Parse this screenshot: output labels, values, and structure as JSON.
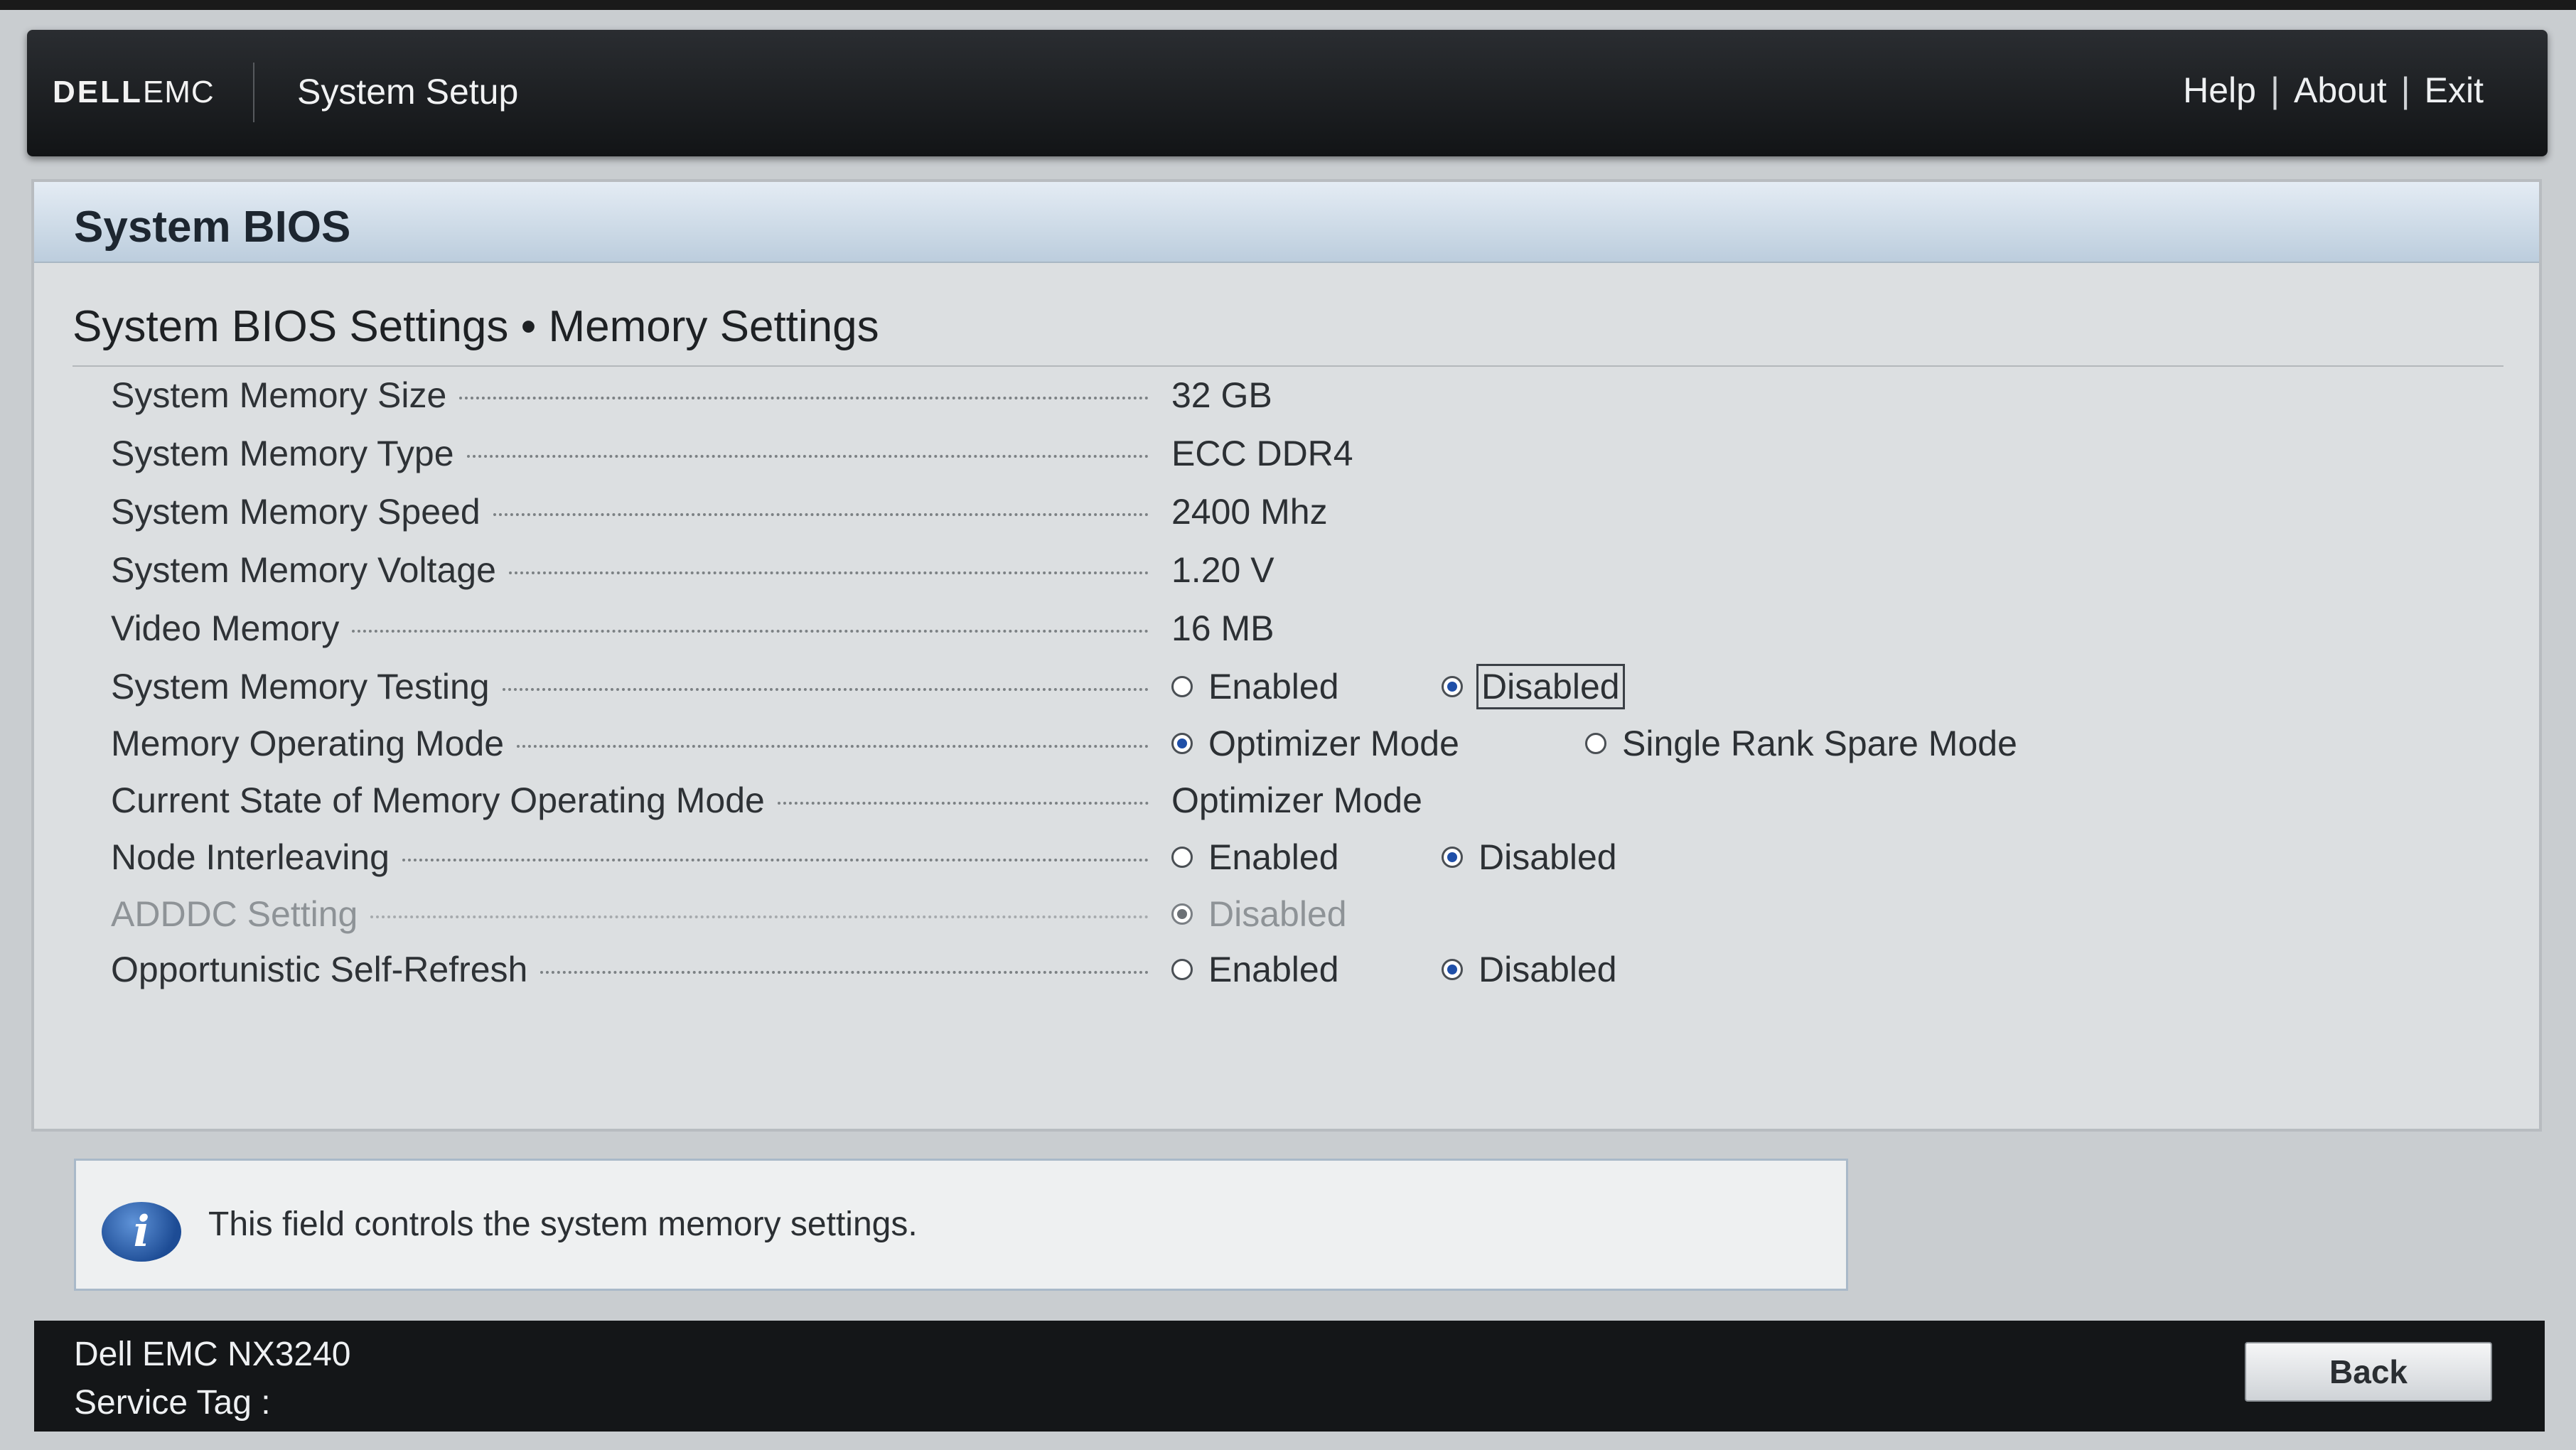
{
  "header": {
    "logo_dell": "DELL",
    "logo_emc": "EMC",
    "title": "System Setup",
    "nav": [
      {
        "label": "Help"
      },
      {
        "label": "About"
      },
      {
        "label": "Exit"
      }
    ],
    "nav_separator": "|"
  },
  "panel": {
    "title": "System BIOS",
    "section_title": "System BIOS Settings • Memory Settings"
  },
  "settings": [
    {
      "label": "System Memory Size",
      "value": "32 GB"
    },
    {
      "label": "System Memory Type",
      "value": "ECC DDR4"
    },
    {
      "label": "System Memory Speed",
      "value": "2400 Mhz"
    },
    {
      "label": "System Memory Voltage",
      "value": "1.20 V"
    },
    {
      "label": "Video Memory",
      "value": "16 MB"
    },
    {
      "label": "System Memory Testing",
      "options": [
        {
          "label": "Enabled",
          "selected": false
        },
        {
          "label": "Disabled",
          "selected": true
        }
      ]
    },
    {
      "label": "Memory Operating Mode",
      "options": [
        {
          "label": "Optimizer Mode",
          "selected": true
        },
        {
          "label": "Single Rank Spare Mode",
          "selected": false
        }
      ]
    },
    {
      "label": "Current State of Memory Operating Mode",
      "value": "Optimizer Mode"
    },
    {
      "label": "Node Interleaving",
      "options": [
        {
          "label": "Enabled",
          "selected": false
        },
        {
          "label": "Disabled",
          "selected": true
        }
      ]
    },
    {
      "label": "ADDDC Setting",
      "options": [
        {
          "label": "Disabled",
          "selected": true
        }
      ],
      "disabled": true
    },
    {
      "label": "Opportunistic Self-Refresh",
      "options": [
        {
          "label": "Enabled",
          "selected": false
        },
        {
          "label": "Disabled",
          "selected": true
        }
      ]
    }
  ],
  "info": {
    "icon": "info-icon",
    "icon_glyph": "i",
    "text": "This field controls the system memory settings."
  },
  "footer": {
    "model": "Dell EMC NX3240",
    "service_tag_label": "Service Tag :",
    "back_label": "Back"
  },
  "colors": {
    "header_bg": "#1c1f22",
    "panel_bg": "#dcdfe1",
    "panel_header_bg": "#c8d6e4",
    "radio_selected": "#1f4fa8",
    "footer_bg": "#141618"
  }
}
